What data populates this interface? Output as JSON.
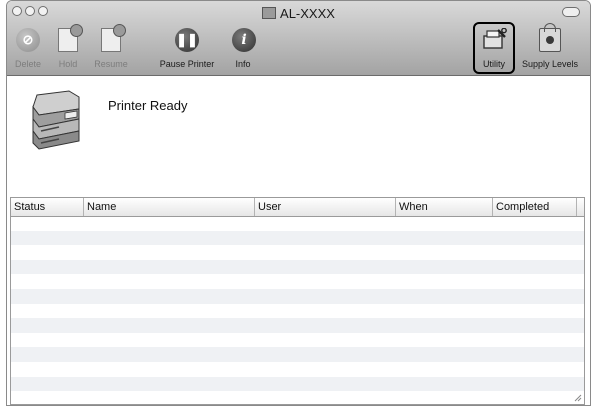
{
  "window": {
    "title": "AL-XXXX"
  },
  "toolbar": {
    "delete_label": "Delete",
    "hold_label": "Hold",
    "resume_label": "Resume",
    "pause_label": "Pause Printer",
    "info_label": "Info",
    "utility_label": "Utility",
    "supply_label": "Supply Levels"
  },
  "printer": {
    "status": "Printer Ready"
  },
  "jobs_table": {
    "columns": [
      "Status",
      "Name",
      "User",
      "When",
      "Completed"
    ],
    "rows": []
  }
}
